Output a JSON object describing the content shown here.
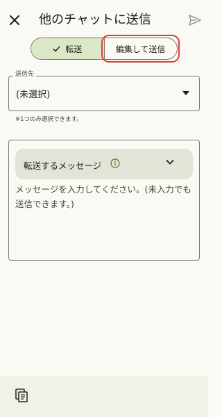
{
  "header": {
    "title": "他のチャットに送信",
    "close_icon": "close-icon",
    "send_icon": "send-icon"
  },
  "mode_toggle": {
    "options": [
      {
        "label": "転送",
        "selected": true,
        "icon": "check-icon"
      },
      {
        "label": "編集して送信",
        "selected": false
      }
    ],
    "highlighted_option": "編集して送信"
  },
  "destination": {
    "label": "送信先",
    "value": "(未選択)",
    "hint": "※1つのみ選択できます。",
    "dropdown_icon": "dropdown-arrow-icon"
  },
  "message": {
    "forward_label": "転送するメッセージ",
    "info_icon": "info-icon",
    "expand_icon": "chevron-down-icon",
    "placeholder": "メッセージを入力してください。(未入力でも送信できます。)"
  },
  "bottom_bar": {
    "copy_icon": "copy-icon"
  },
  "colors": {
    "background": "#fbf9f3",
    "selected_segment": "#dce7c8",
    "forward_bar": "#e3e3d8",
    "highlight": "#e53935",
    "info_green": "#4f7a28",
    "outline": "#76786c"
  }
}
